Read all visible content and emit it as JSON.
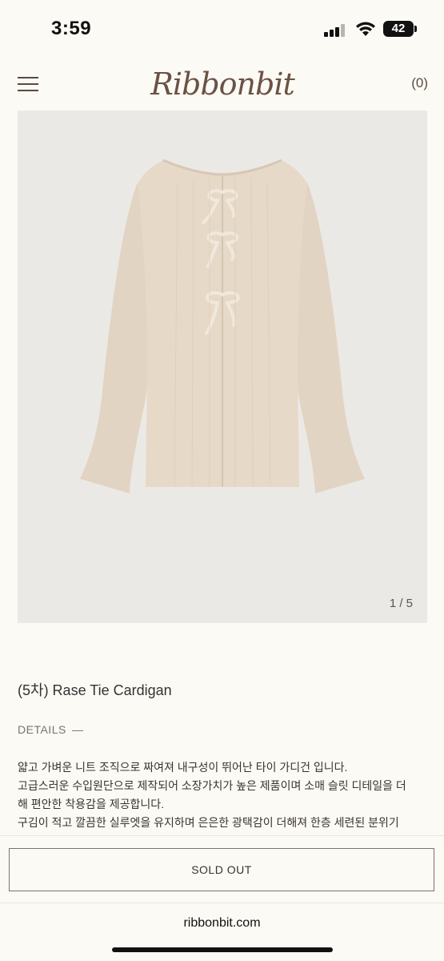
{
  "status_bar": {
    "time": "3:59",
    "battery": "42"
  },
  "header": {
    "logo": "Ribbonbit",
    "cart": "(0)"
  },
  "gallery": {
    "counter": "1 / 5"
  },
  "product": {
    "title": "(5차) Rase Tie Cardigan",
    "details_label": "DETAILS",
    "details_toggle": "—",
    "description": [
      "얇고 가벼운 니트 조직으로 짜여져 내구성이 뛰어난 타이 가디건 입니다.",
      "고급스러운 수입원단으로 제작되어 소장가치가 높은 제품이며 소매 슬릿 디테일을 더",
      "해 편안한 착용감을 제공합니다.",
      "구김이 적고 깔끔한 실루엣을 유지하며 은은한 광택감이 더해져 한층 세련된 분위기"
    ]
  },
  "actions": {
    "soldout": "SOLD OUT"
  },
  "browser": {
    "url": "ribbonbit.com"
  },
  "colors": {
    "background": "#fcfaf4",
    "accent": "#6b5246",
    "image_bg": "#ebe9e5",
    "garment": "#e4d6c4"
  },
  "icons": [
    "signal-icon",
    "wifi-icon",
    "battery-icon",
    "menu-icon"
  ]
}
